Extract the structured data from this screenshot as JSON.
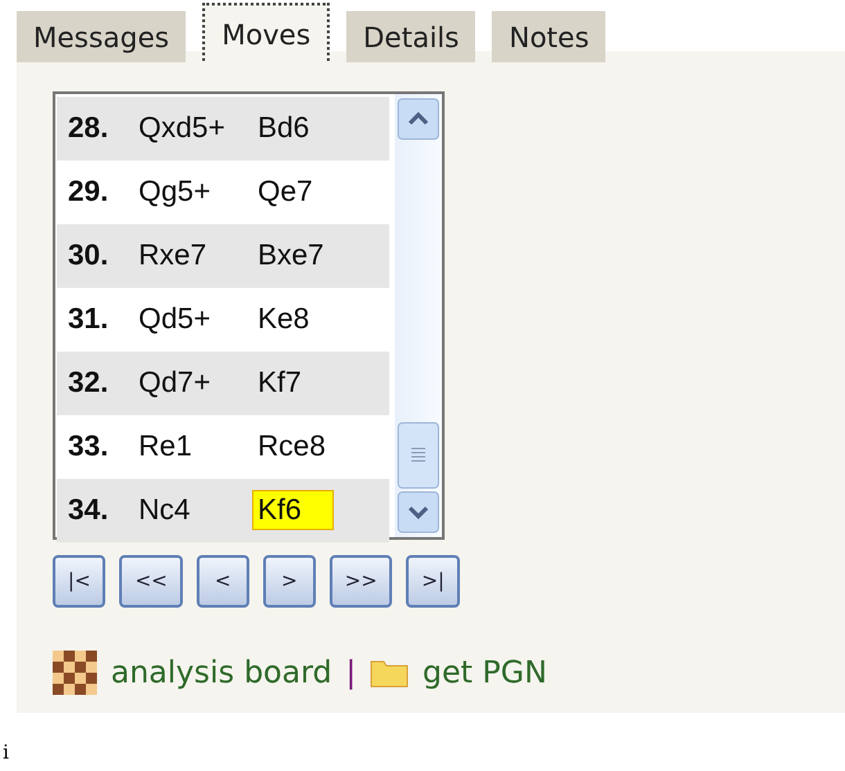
{
  "tabs": [
    {
      "label": "Messages",
      "selected": false
    },
    {
      "label": "Moves",
      "selected": true
    },
    {
      "label": "Details",
      "selected": false
    },
    {
      "label": "Notes",
      "selected": false
    }
  ],
  "moves": [
    {
      "number": "28.",
      "white": {
        "text": "Qxd5+",
        "current": false
      },
      "black": {
        "text": "Bd6",
        "current": false
      }
    },
    {
      "number": "29.",
      "white": {
        "text": "Qg5+",
        "current": false
      },
      "black": {
        "text": "Qe7",
        "current": false
      }
    },
    {
      "number": "30.",
      "white": {
        "text": "Rxe7",
        "current": false
      },
      "black": {
        "text": "Bxe7",
        "current": false
      }
    },
    {
      "number": "31.",
      "white": {
        "text": "Qd5+",
        "current": false
      },
      "black": {
        "text": "Ke8",
        "current": false
      }
    },
    {
      "number": "32.",
      "white": {
        "text": "Qd7+",
        "current": false
      },
      "black": {
        "text": "Kf7",
        "current": false
      }
    },
    {
      "number": "33.",
      "white": {
        "text": "Re1",
        "current": false
      },
      "black": {
        "text": "Rce8",
        "current": false
      }
    },
    {
      "number": "34.",
      "white": {
        "text": "Nc4",
        "current": false
      },
      "black": {
        "text": "Kf6",
        "current": true
      }
    }
  ],
  "nav_buttons": [
    "|<",
    "<<",
    "<",
    ">",
    ">>",
    ">|"
  ],
  "links": {
    "analysis": "analysis board",
    "separator": "|",
    "pgn": "get PGN"
  },
  "stray_text": "i"
}
